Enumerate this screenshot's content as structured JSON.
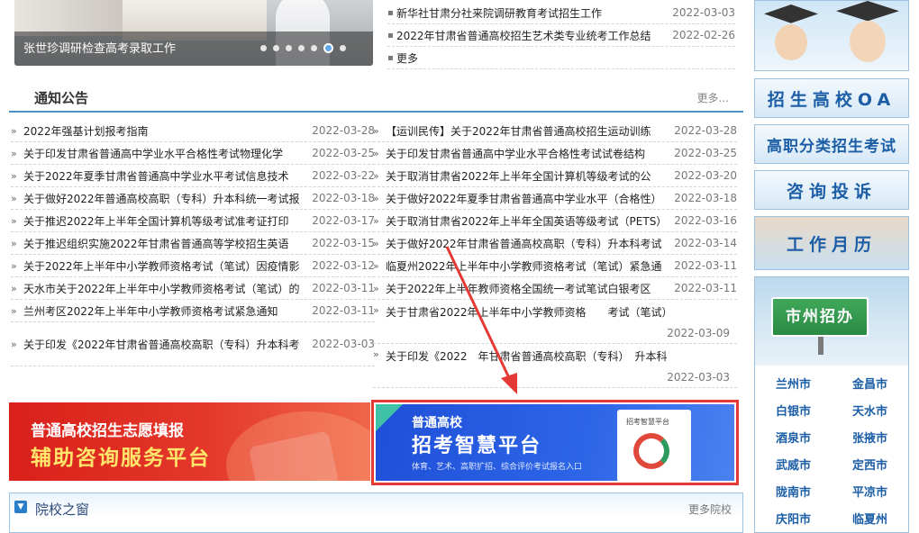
{
  "hero": {
    "caption": "张世珍调研检查高考录取工作",
    "slide_count": 6,
    "active_slide": 6
  },
  "top_news": [
    {
      "title": "新华社甘肃分社来院调研教育考试招生工作",
      "date": "2022-03-03"
    },
    {
      "title": "2022年甘肃省普通高校招生艺术类专业统考工作总结",
      "date": "2022-02-26"
    },
    {
      "title": "更多",
      "date": ""
    }
  ],
  "notice": {
    "title": "通知公告",
    "more": "更多..."
  },
  "left_items": [
    {
      "title": "2022年强基计划报考指南",
      "date": "2022-03-28"
    },
    {
      "title": "关于印发甘肃省普通高中学业水平合格性考试物理化学",
      "date": "2022-03-25"
    },
    {
      "title": "关于2022年夏季甘肃省普通高中学业水平考试信息技术",
      "date": "2022-03-22"
    },
    {
      "title": "关于做好2022年普通高校高职（专科）升本科统一考试报",
      "date": "2022-03-18"
    },
    {
      "title": "关于推迟2022年上半年全国计算机等级考试准考证打印",
      "date": "2022-03-17"
    },
    {
      "title": "关于推迟组织实施2022年甘肃省普通高等学校招生英语",
      "date": "2022-03-15"
    },
    {
      "title": "关于2022年上半年中小学教师资格考试（笔试）因疫情影",
      "date": "2022-03-12"
    },
    {
      "title": "天水市关于2022年上半年中小学教师资格考试（笔试）的",
      "date": "2022-03-11"
    },
    {
      "title": "兰州考区2022年上半年中小学教师资格考试紧急通知",
      "date": "2022-03-11"
    },
    {
      "title": "关于印发《2022年甘肃省普通高校高职（专科）升本科考",
      "date": "2022-03-03"
    }
  ],
  "right_items": [
    {
      "title": "【运训民传】关于2022年甘肃省普通高校招生运动训练",
      "date": "2022-03-28"
    },
    {
      "title": "关于印发甘肃省普通高中学业水平合格性考试试卷结构",
      "date": "2022-03-25"
    },
    {
      "title": "关于取消甘肃省2022年上半年全国计算机等级考试的公",
      "date": "2022-03-20"
    },
    {
      "title": "关于做好2022年夏季甘肃省普通高中学业水平（合格性）",
      "date": "2022-03-18"
    },
    {
      "title": "关于取消甘肃省2022年上半年全国英语等级考试（PETS）",
      "date": "2022-03-16"
    },
    {
      "title": "关于做好2022年甘肃省普通高校高职（专科）升本科考试",
      "date": "2022-03-14"
    },
    {
      "title": "临夏州2022年上半年中小学教师资格考试（笔试）紧急通",
      "date": "2022-03-11"
    },
    {
      "title": "关于2022年上半年教师资格全国统一考试笔试白银考区",
      "date": "2022-03-11"
    },
    {
      "title": "关于甘肃省2022年上半年中小学教师资格　　考试（笔试）",
      "date": "2022-03-09"
    },
    {
      "title": "关于印发《2022　年甘肃省普通高校高职（专科）　升本科",
      "date": "2022-03-03"
    }
  ],
  "banner_red": {
    "line1": "普通高校招生志愿填报",
    "line2": "辅助咨询服务平台"
  },
  "banner_blue": {
    "line1": "普通高校",
    "line2": "招考智慧平台",
    "line3": "体育、艺术、高职扩招、综合评价考试报名入口",
    "card_title": "招考智慧平台"
  },
  "school_window": {
    "title": "院校之窗",
    "more": "更多院校"
  },
  "sidebar": {
    "btn_oa": "招生高校OA",
    "btn_vocational": "高职分类招生考试",
    "btn_consult": "咨询投诉",
    "btn_calendar": "工作月历",
    "city_sign": "市州招办",
    "cities": [
      "兰州市",
      "金昌市",
      "白银市",
      "天水市",
      "酒泉市",
      "张掖市",
      "武威市",
      "定西市",
      "陇南市",
      "平凉市",
      "庆阳市",
      "临夏州"
    ]
  },
  "colors": {
    "accent_blue": "#4a90c8",
    "highlight_border": "#e53935",
    "link_blue": "#1b5ea6"
  }
}
